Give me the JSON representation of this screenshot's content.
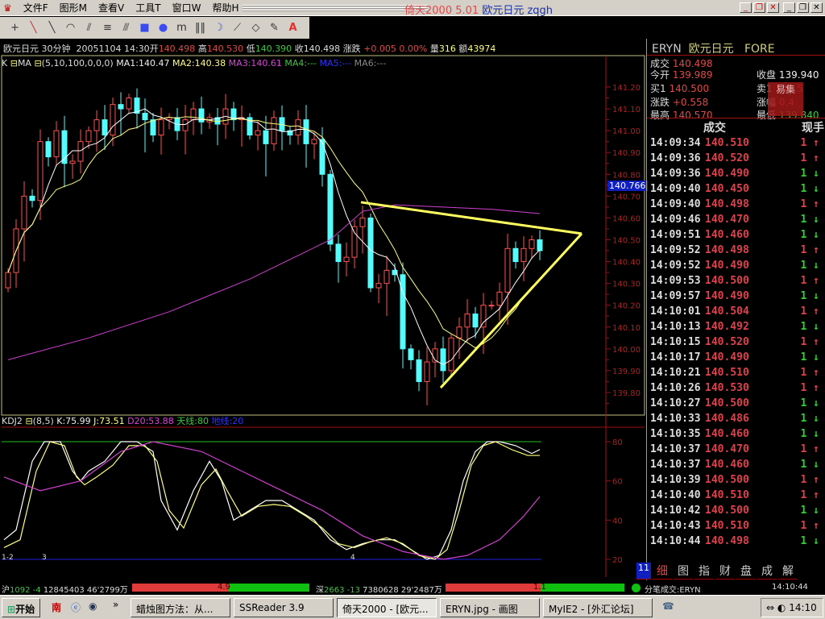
{
  "menu": {
    "items": [
      "文件F",
      "图形M",
      "查看V",
      "工具T",
      "窗口W",
      "帮助H"
    ],
    "title_app": "倚天2000 5.01",
    "title_doc": "欧元日元 zqgh"
  },
  "toolbar": {
    "tools": [
      "crosshair",
      "line",
      "segment",
      "arc",
      "fan",
      "parallel-lines",
      "gann-fan",
      "rectangle",
      "ellipse",
      "cycle",
      "vertical-lines",
      "moon",
      "channel",
      "eraser",
      "pen",
      "text"
    ]
  },
  "info": {
    "symbol": "欧元日元",
    "period": "30分钟",
    "datetime": "20051104 14:30",
    "open_label": "开",
    "open": "140.498",
    "high_label": "高",
    "high": "140.530",
    "low_label": "低",
    "low": "140.390",
    "close_label": "收",
    "close": "140.498",
    "change_label": "涨跌",
    "change": "+0.005 0.00%",
    "volume_label": "量",
    "volume": "316",
    "amount_label": "额",
    "amount": "43974"
  },
  "ma_header": {
    "k": "K",
    "name": "MA",
    "params": "(5,10,100,0,0,0)",
    "ma1": "MA1:140.47",
    "ma2": "MA2:140.38",
    "ma3": "MA3:140.61",
    "ma4": "MA4:---",
    "ma5": "MA5:---",
    "ma6": "MA6:---"
  },
  "kdj_header": {
    "name": "KDJ2",
    "params": "(8,5)",
    "k": "K:75.99",
    "j": "J:73.51",
    "d20": "D20:53.88",
    "top": "天线:80",
    "bottom": "地线:20"
  },
  "cursor_price": "140.766",
  "chart_data": [
    {
      "type": "candlestick",
      "title": "欧元日元 30分钟",
      "closes": [
        140.35,
        140.55,
        140.7,
        140.68,
        140.95,
        140.88,
        141.0,
        140.85,
        140.86,
        140.95,
        141.0,
        141.05,
        140.98,
        141.12,
        141.1,
        141.15,
        141.08,
        141.05,
        140.98,
        141.05,
        141.06,
        141.0,
        141.05,
        141.1,
        141.04,
        141.06,
        141.03,
        141.1,
        141.05,
        141.06,
        140.98,
        141.0,
        140.94,
        141.06,
        141.0,
        140.98,
        141.05,
        140.94,
        140.96,
        140.8,
        140.48,
        140.4,
        140.42,
        140.56,
        140.6,
        140.28,
        140.3,
        140.36,
        140.34,
        140.0,
        139.95,
        139.85,
        139.94,
        140.0,
        139.9,
        140.05,
        140.1,
        140.16,
        140.1,
        140.2,
        140.2,
        140.26,
        140.46,
        140.4,
        140.46,
        140.5,
        140.45
      ],
      "first_open": 140.28,
      "yticks": [
        "141.20",
        "141.10",
        "141.00",
        "140.90",
        "140.80",
        "140.70",
        "140.60",
        "140.50",
        "140.40",
        "140.30",
        "140.20",
        "140.10",
        "140.00",
        "139.90",
        "139.80"
      ],
      "ylim": [
        139.78,
        141.26
      ],
      "ma3_line": [
        [
          0,
          139.95
        ],
        [
          10,
          140.05
        ],
        [
          20,
          140.17
        ],
        [
          30,
          140.32
        ],
        [
          40,
          140.5
        ],
        [
          44,
          140.63
        ],
        [
          48,
          140.66
        ],
        [
          60,
          140.64
        ],
        [
          66,
          140.62
        ]
      ],
      "trendlines": [
        {
          "from": [
            43.8,
            140.672
          ],
          "to": [
            71.2,
            140.528
          ]
        },
        {
          "from": [
            53.7,
            139.822
          ],
          "to": [
            71.2,
            140.528
          ]
        }
      ],
      "x_markers": [
        "1-2",
        "3",
        "4"
      ]
    },
    {
      "type": "line",
      "title": "KDJ2",
      "ylim": [
        20,
        85
      ],
      "yticks": [
        "80",
        "60",
        "40",
        "20"
      ],
      "series": [
        {
          "name": "K",
          "color": "#ffffff",
          "points": [
            [
              5,
              30
            ],
            [
              20,
              35
            ],
            [
              40,
              70
            ],
            [
              55,
              80
            ],
            [
              75,
              80
            ],
            [
              90,
              65
            ],
            [
              100,
              60
            ],
            [
              110,
              65
            ],
            [
              130,
              70
            ],
            [
              150,
              80
            ],
            [
              170,
              80
            ],
            [
              190,
              75
            ],
            [
              200,
              50
            ],
            [
              220,
              35
            ],
            [
              240,
              55
            ],
            [
              260,
              70
            ],
            [
              275,
              60
            ],
            [
              290,
              40
            ],
            [
              310,
              45
            ],
            [
              330,
              50
            ],
            [
              350,
              50
            ],
            [
              370,
              45
            ],
            [
              390,
              40
            ],
            [
              410,
              30
            ],
            [
              430,
              25
            ],
            [
              450,
              28
            ],
            [
              470,
              30
            ],
            [
              490,
              30
            ],
            [
              510,
              25
            ],
            [
              530,
              20
            ],
            [
              545,
              22
            ],
            [
              560,
              35
            ],
            [
              575,
              60
            ],
            [
              590,
              75
            ],
            [
              605,
              80
            ],
            [
              620,
              80
            ],
            [
              640,
              78
            ],
            [
              660,
              74
            ],
            [
              670,
              76
            ]
          ]
        },
        {
          "name": "J",
          "color": "#ffff80",
          "points": [
            [
              5,
              26
            ],
            [
              25,
              30
            ],
            [
              45,
              65
            ],
            [
              62,
              80
            ],
            [
              80,
              78
            ],
            [
              95,
              62
            ],
            [
              105,
              58
            ],
            [
              120,
              62
            ],
            [
              140,
              68
            ],
            [
              160,
              78
            ],
            [
              180,
              78
            ],
            [
              195,
              70
            ],
            [
              210,
              45
            ],
            [
              228,
              36
            ],
            [
              250,
              58
            ],
            [
              268,
              66
            ],
            [
              282,
              55
            ],
            [
              300,
              42
            ],
            [
              320,
              47
            ],
            [
              340,
              48
            ],
            [
              360,
              47
            ],
            [
              380,
              42
            ],
            [
              400,
              36
            ],
            [
              420,
              28
            ],
            [
              440,
              26
            ],
            [
              460,
              29
            ],
            [
              480,
              31
            ],
            [
              500,
              28
            ],
            [
              520,
              22
            ],
            [
              540,
              20
            ],
            [
              555,
              25
            ],
            [
              570,
              45
            ],
            [
              585,
              68
            ],
            [
              600,
              78
            ],
            [
              615,
              80
            ],
            [
              635,
              76
            ],
            [
              655,
              73
            ],
            [
              670,
              73
            ]
          ]
        },
        {
          "name": "D20",
          "color": "#d040d0",
          "points": [
            [
              5,
              62
            ],
            [
              50,
              55
            ],
            [
              100,
              60
            ],
            [
              150,
              75
            ],
            [
              190,
              80
            ],
            [
              250,
              75
            ],
            [
              300,
              65
            ],
            [
              350,
              55
            ],
            [
              400,
              45
            ],
            [
              450,
              32
            ],
            [
              500,
              24
            ],
            [
              550,
              20
            ],
            [
              580,
              22
            ],
            [
              620,
              30
            ],
            [
              650,
              42
            ],
            [
              670,
              52
            ]
          ]
        }
      ]
    }
  ],
  "right": {
    "code": "ERYN",
    "name": "欧元日元",
    "market": "FORE",
    "quotes": [
      {
        "label": "成交",
        "value": "140.498",
        "color": "r"
      },
      {
        "label": "今开",
        "value": "139.989",
        "color": "r"
      },
      {
        "label": "收盘",
        "value": "139.940",
        "color": "w"
      },
      {
        "label": "买1",
        "value": "140.500",
        "color": "r"
      },
      {
        "label": "卖1",
        "value": "140.5",
        "color": "r"
      },
      {
        "label": "涨跌",
        "value": "+0.558",
        "color": "r"
      },
      {
        "label": "涨幅",
        "value": "0.4",
        "color": "r"
      },
      {
        "label": "最高",
        "value": "140.570",
        "color": "r"
      },
      {
        "label": "最低",
        "value": "139.840",
        "color": "g"
      }
    ],
    "logo_text": "易集",
    "trade_header": {
      "price": "成交",
      "vol": "现手"
    },
    "trades": [
      [
        "14:09:34",
        "140.510",
        "1",
        "up"
      ],
      [
        "14:09:36",
        "140.520",
        "1",
        "up"
      ],
      [
        "14:09:36",
        "140.490",
        "1",
        "down"
      ],
      [
        "14:09:40",
        "140.450",
        "1",
        "down"
      ],
      [
        "14:09:40",
        "140.498",
        "1",
        "up"
      ],
      [
        "14:09:46",
        "140.470",
        "1",
        "down"
      ],
      [
        "14:09:51",
        "140.460",
        "1",
        "down"
      ],
      [
        "14:09:52",
        "140.498",
        "1",
        "up"
      ],
      [
        "14:09:52",
        "140.490",
        "1",
        "down"
      ],
      [
        "14:09:53",
        "140.500",
        "1",
        "up"
      ],
      [
        "14:09:57",
        "140.490",
        "1",
        "down"
      ],
      [
        "14:10:01",
        "140.504",
        "1",
        "up"
      ],
      [
        "14:10:13",
        "140.492",
        "1",
        "down"
      ],
      [
        "14:10:15",
        "140.520",
        "1",
        "up"
      ],
      [
        "14:10:17",
        "140.490",
        "1",
        "down"
      ],
      [
        "14:10:21",
        "140.510",
        "1",
        "up"
      ],
      [
        "14:10:26",
        "140.530",
        "1",
        "up"
      ],
      [
        "14:10:27",
        "140.500",
        "1",
        "down"
      ],
      [
        "14:10:33",
        "140.486",
        "1",
        "down"
      ],
      [
        "14:10:35",
        "140.460",
        "1",
        "down"
      ],
      [
        "14:10:37",
        "140.470",
        "1",
        "up"
      ],
      [
        "14:10:37",
        "140.460",
        "1",
        "down"
      ],
      [
        "14:10:39",
        "140.500",
        "1",
        "up"
      ],
      [
        "14:10:40",
        "140.510",
        "1",
        "up"
      ],
      [
        "14:10:42",
        "140.500",
        "1",
        "down"
      ],
      [
        "14:10:43",
        "140.510",
        "1",
        "up"
      ],
      [
        "14:10:44",
        "140.498",
        "1",
        "down"
      ]
    ],
    "tabs": [
      "细",
      "图",
      "指",
      "财",
      "盘",
      "成",
      "解"
    ],
    "page": "11"
  },
  "status": {
    "sh_label": "沪",
    "sh_index": "1092",
    "sh_change": "-4",
    "sh_vol": "12845403",
    "sh_amt": "46'2799万",
    "sh_ratio": "4.9",
    "sz_label": "深",
    "sz_index": "2663",
    "sz_change": "-13",
    "sz_vol": "7380628",
    "sz_amt": "29'2487万",
    "sz_ratio": "1.1",
    "ticker": "分笔成交:ERYN",
    "time": "14:10:44"
  },
  "taskbar": {
    "start": "开始",
    "tasks": [
      "蜡烛图方法：从...",
      "SSReader 3.9",
      "倚天2000 - [欧元...",
      "ERYN.jpg - 画图",
      "MyIE2 - [外汇论坛]"
    ],
    "clock": "14:10"
  },
  "colors": {
    "up": "#ff5050",
    "down": "#54fcfc",
    "ma1": "#ffffff",
    "ma2": "#ffff80",
    "ma3": "#d040d0",
    "trend": "#ffff60",
    "axis": "#a01010"
  }
}
